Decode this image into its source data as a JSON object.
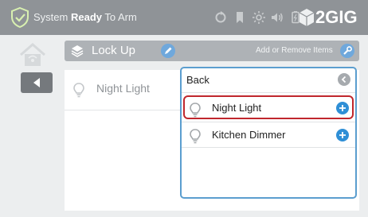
{
  "topbar": {
    "status_prefix": "System ",
    "status_bold": "Ready",
    "status_suffix": " To Arm",
    "brand": "2GIG",
    "icons": [
      "shield-check-icon",
      "refresh-icon",
      "bookmark-icon",
      "brightness-icon",
      "volume-icon",
      "battery-icon",
      "brand-cube-icon"
    ]
  },
  "header": {
    "title": "Lock Up",
    "add_remove": "Add or Remove Items"
  },
  "list": {
    "items": [
      {
        "label": "Night Light"
      }
    ]
  },
  "popup": {
    "back_label": "Back",
    "items": [
      {
        "label": "Night Light",
        "selected": true
      },
      {
        "label": "Kitchen Dimmer",
        "selected": false
      }
    ]
  },
  "colors": {
    "topbar": "#8f9397",
    "accent_blue": "#2f8fd6",
    "selection_red": "#c0272d",
    "popup_border": "#5b9ecf"
  }
}
